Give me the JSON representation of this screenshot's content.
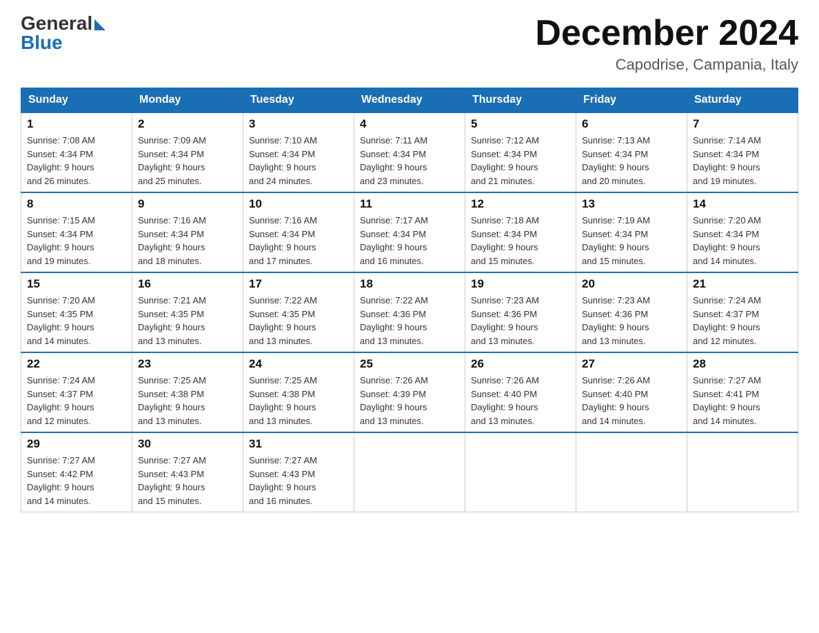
{
  "header": {
    "logo_general": "General",
    "logo_blue": "Blue",
    "month_title": "December 2024",
    "location": "Capodrise, Campania, Italy"
  },
  "weekdays": [
    "Sunday",
    "Monday",
    "Tuesday",
    "Wednesday",
    "Thursday",
    "Friday",
    "Saturday"
  ],
  "weeks": [
    [
      {
        "day": "1",
        "sunrise": "7:08 AM",
        "sunset": "4:34 PM",
        "daylight": "9 hours and 26 minutes."
      },
      {
        "day": "2",
        "sunrise": "7:09 AM",
        "sunset": "4:34 PM",
        "daylight": "9 hours and 25 minutes."
      },
      {
        "day": "3",
        "sunrise": "7:10 AM",
        "sunset": "4:34 PM",
        "daylight": "9 hours and 24 minutes."
      },
      {
        "day": "4",
        "sunrise": "7:11 AM",
        "sunset": "4:34 PM",
        "daylight": "9 hours and 23 minutes."
      },
      {
        "day": "5",
        "sunrise": "7:12 AM",
        "sunset": "4:34 PM",
        "daylight": "9 hours and 21 minutes."
      },
      {
        "day": "6",
        "sunrise": "7:13 AM",
        "sunset": "4:34 PM",
        "daylight": "9 hours and 20 minutes."
      },
      {
        "day": "7",
        "sunrise": "7:14 AM",
        "sunset": "4:34 PM",
        "daylight": "9 hours and 19 minutes."
      }
    ],
    [
      {
        "day": "8",
        "sunrise": "7:15 AM",
        "sunset": "4:34 PM",
        "daylight": "9 hours and 19 minutes."
      },
      {
        "day": "9",
        "sunrise": "7:16 AM",
        "sunset": "4:34 PM",
        "daylight": "9 hours and 18 minutes."
      },
      {
        "day": "10",
        "sunrise": "7:16 AM",
        "sunset": "4:34 PM",
        "daylight": "9 hours and 17 minutes."
      },
      {
        "day": "11",
        "sunrise": "7:17 AM",
        "sunset": "4:34 PM",
        "daylight": "9 hours and 16 minutes."
      },
      {
        "day": "12",
        "sunrise": "7:18 AM",
        "sunset": "4:34 PM",
        "daylight": "9 hours and 15 minutes."
      },
      {
        "day": "13",
        "sunrise": "7:19 AM",
        "sunset": "4:34 PM",
        "daylight": "9 hours and 15 minutes."
      },
      {
        "day": "14",
        "sunrise": "7:20 AM",
        "sunset": "4:34 PM",
        "daylight": "9 hours and 14 minutes."
      }
    ],
    [
      {
        "day": "15",
        "sunrise": "7:20 AM",
        "sunset": "4:35 PM",
        "daylight": "9 hours and 14 minutes."
      },
      {
        "day": "16",
        "sunrise": "7:21 AM",
        "sunset": "4:35 PM",
        "daylight": "9 hours and 13 minutes."
      },
      {
        "day": "17",
        "sunrise": "7:22 AM",
        "sunset": "4:35 PM",
        "daylight": "9 hours and 13 minutes."
      },
      {
        "day": "18",
        "sunrise": "7:22 AM",
        "sunset": "4:36 PM",
        "daylight": "9 hours and 13 minutes."
      },
      {
        "day": "19",
        "sunrise": "7:23 AM",
        "sunset": "4:36 PM",
        "daylight": "9 hours and 13 minutes."
      },
      {
        "day": "20",
        "sunrise": "7:23 AM",
        "sunset": "4:36 PM",
        "daylight": "9 hours and 13 minutes."
      },
      {
        "day": "21",
        "sunrise": "7:24 AM",
        "sunset": "4:37 PM",
        "daylight": "9 hours and 12 minutes."
      }
    ],
    [
      {
        "day": "22",
        "sunrise": "7:24 AM",
        "sunset": "4:37 PM",
        "daylight": "9 hours and 12 minutes."
      },
      {
        "day": "23",
        "sunrise": "7:25 AM",
        "sunset": "4:38 PM",
        "daylight": "9 hours and 13 minutes."
      },
      {
        "day": "24",
        "sunrise": "7:25 AM",
        "sunset": "4:38 PM",
        "daylight": "9 hours and 13 minutes."
      },
      {
        "day": "25",
        "sunrise": "7:26 AM",
        "sunset": "4:39 PM",
        "daylight": "9 hours and 13 minutes."
      },
      {
        "day": "26",
        "sunrise": "7:26 AM",
        "sunset": "4:40 PM",
        "daylight": "9 hours and 13 minutes."
      },
      {
        "day": "27",
        "sunrise": "7:26 AM",
        "sunset": "4:40 PM",
        "daylight": "9 hours and 14 minutes."
      },
      {
        "day": "28",
        "sunrise": "7:27 AM",
        "sunset": "4:41 PM",
        "daylight": "9 hours and 14 minutes."
      }
    ],
    [
      {
        "day": "29",
        "sunrise": "7:27 AM",
        "sunset": "4:42 PM",
        "daylight": "9 hours and 14 minutes."
      },
      {
        "day": "30",
        "sunrise": "7:27 AM",
        "sunset": "4:43 PM",
        "daylight": "9 hours and 15 minutes."
      },
      {
        "day": "31",
        "sunrise": "7:27 AM",
        "sunset": "4:43 PM",
        "daylight": "9 hours and 16 minutes."
      },
      null,
      null,
      null,
      null
    ]
  ]
}
